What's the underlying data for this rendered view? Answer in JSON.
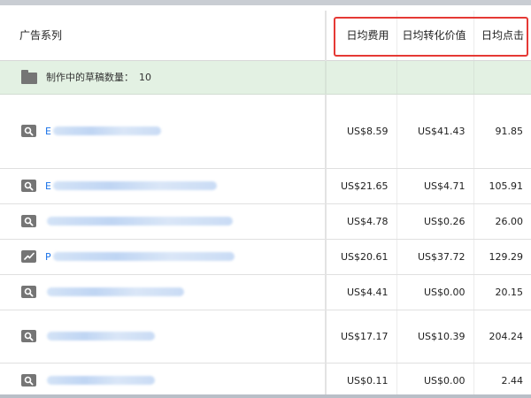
{
  "header": {
    "campaign_col": "广告系列",
    "avg_cost_col": "日均费用",
    "avg_conv_value_col": "日均转化价值",
    "avg_clicks_col": "日均点击"
  },
  "drafts": {
    "label": "制作中的草稿数量：",
    "count": "10"
  },
  "rows": [
    {
      "icon": "search-icon",
      "name_prefix": "E",
      "cost": "US$8.59",
      "conv_value": "US$41.43",
      "clicks": "91.85"
    },
    {
      "icon": "search-icon",
      "name_prefix": "E",
      "cost": "US$21.65",
      "conv_value": "US$4.71",
      "clicks": "105.91"
    },
    {
      "icon": "search-icon",
      "name_prefix": "",
      "cost": "US$4.78",
      "conv_value": "US$0.26",
      "clicks": "26.00"
    },
    {
      "icon": "trending-icon",
      "name_prefix": "P",
      "cost": "US$20.61",
      "conv_value": "US$37.72",
      "clicks": "129.29"
    },
    {
      "icon": "search-icon",
      "name_prefix": "",
      "cost": "US$4.41",
      "conv_value": "US$0.00",
      "clicks": "20.15"
    },
    {
      "icon": "search-icon",
      "name_prefix": "",
      "cost": "US$17.17",
      "conv_value": "US$10.39",
      "clicks": "204.24"
    },
    {
      "icon": "search-icon",
      "name_prefix": "",
      "cost": "US$0.11",
      "conv_value": "US$0.00",
      "clicks": "2.44"
    }
  ],
  "colors": {
    "highlight_box": "#e53935",
    "draft_row_bg": "#e3f1e3",
    "link": "#1a73e8",
    "icon": "#757575"
  }
}
